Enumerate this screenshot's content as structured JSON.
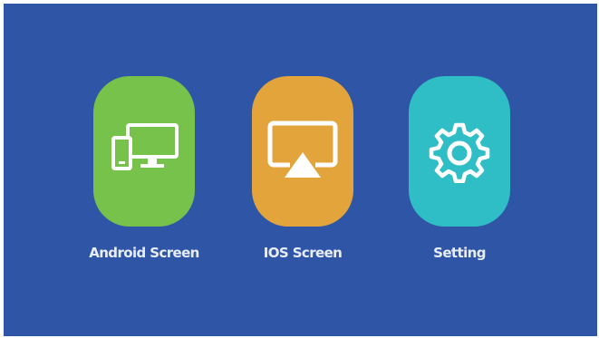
{
  "screen": {
    "background_color": "#2f56a6",
    "items": [
      {
        "label": "Android Screen",
        "icon": "devices-icon",
        "color": "#76c24a"
      },
      {
        "label": "IOS Screen",
        "icon": "airplay-icon",
        "color": "#e3a43c"
      },
      {
        "label": "Setting",
        "icon": "gear-icon",
        "color": "#2fbec6"
      }
    ]
  }
}
